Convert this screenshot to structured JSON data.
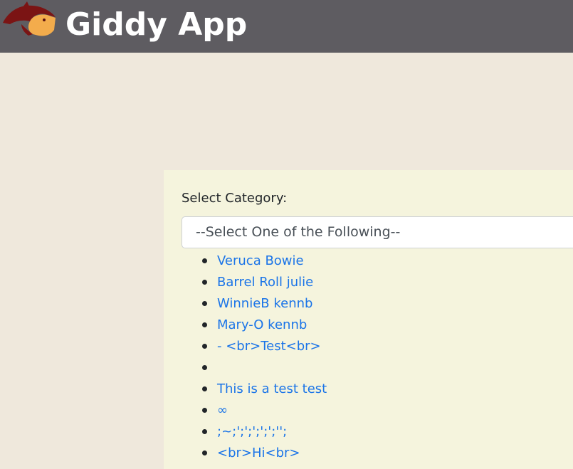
{
  "header": {
    "title": "Giddy App",
    "logo_icon": "horse-head-icon",
    "background": "#5e5c61"
  },
  "form": {
    "label": "Select Category:",
    "select_value": "--Select One of the Following--"
  },
  "list": {
    "items": [
      {
        "label": "Veruca Bowie"
      },
      {
        "label": "Barrel Roll julie"
      },
      {
        "label": "WinnieB kennb"
      },
      {
        "label": "Mary-O kennb"
      },
      {
        "label": "- <br>Test<br>"
      },
      {
        "label": ""
      },
      {
        "label": "This is a test test"
      },
      {
        "label": "∞"
      },
      {
        "label": ";~;';';';';';'';"
      },
      {
        "label": "<br>Hi<br>"
      }
    ]
  },
  "colors": {
    "page_bg": "#efe8dc",
    "panel_bg": "#f5f4dd",
    "link": "#1a74e8"
  }
}
